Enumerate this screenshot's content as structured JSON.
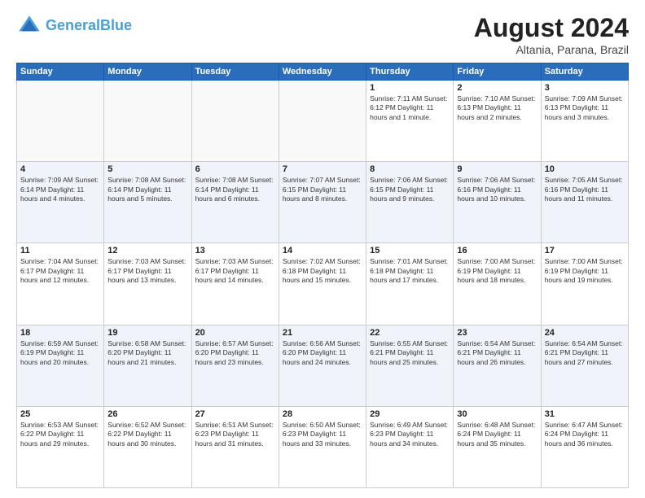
{
  "header": {
    "logo_line1": "General",
    "logo_line2": "Blue",
    "month_year": "August 2024",
    "location": "Altania, Parana, Brazil"
  },
  "days_of_week": [
    "Sunday",
    "Monday",
    "Tuesday",
    "Wednesday",
    "Thursday",
    "Friday",
    "Saturday"
  ],
  "weeks": [
    [
      {
        "day": "",
        "text": ""
      },
      {
        "day": "",
        "text": ""
      },
      {
        "day": "",
        "text": ""
      },
      {
        "day": "",
        "text": ""
      },
      {
        "day": "1",
        "text": "Sunrise: 7:11 AM\nSunset: 6:12 PM\nDaylight: 11 hours\nand 1 minute."
      },
      {
        "day": "2",
        "text": "Sunrise: 7:10 AM\nSunset: 6:13 PM\nDaylight: 11 hours\nand 2 minutes."
      },
      {
        "day": "3",
        "text": "Sunrise: 7:09 AM\nSunset: 6:13 PM\nDaylight: 11 hours\nand 3 minutes."
      }
    ],
    [
      {
        "day": "4",
        "text": "Sunrise: 7:09 AM\nSunset: 6:14 PM\nDaylight: 11 hours\nand 4 minutes."
      },
      {
        "day": "5",
        "text": "Sunrise: 7:08 AM\nSunset: 6:14 PM\nDaylight: 11 hours\nand 5 minutes."
      },
      {
        "day": "6",
        "text": "Sunrise: 7:08 AM\nSunset: 6:14 PM\nDaylight: 11 hours\nand 6 minutes."
      },
      {
        "day": "7",
        "text": "Sunrise: 7:07 AM\nSunset: 6:15 PM\nDaylight: 11 hours\nand 8 minutes."
      },
      {
        "day": "8",
        "text": "Sunrise: 7:06 AM\nSunset: 6:15 PM\nDaylight: 11 hours\nand 9 minutes."
      },
      {
        "day": "9",
        "text": "Sunrise: 7:06 AM\nSunset: 6:16 PM\nDaylight: 11 hours\nand 10 minutes."
      },
      {
        "day": "10",
        "text": "Sunrise: 7:05 AM\nSunset: 6:16 PM\nDaylight: 11 hours\nand 11 minutes."
      }
    ],
    [
      {
        "day": "11",
        "text": "Sunrise: 7:04 AM\nSunset: 6:17 PM\nDaylight: 11 hours\nand 12 minutes."
      },
      {
        "day": "12",
        "text": "Sunrise: 7:03 AM\nSunset: 6:17 PM\nDaylight: 11 hours\nand 13 minutes."
      },
      {
        "day": "13",
        "text": "Sunrise: 7:03 AM\nSunset: 6:17 PM\nDaylight: 11 hours\nand 14 minutes."
      },
      {
        "day": "14",
        "text": "Sunrise: 7:02 AM\nSunset: 6:18 PM\nDaylight: 11 hours\nand 15 minutes."
      },
      {
        "day": "15",
        "text": "Sunrise: 7:01 AM\nSunset: 6:18 PM\nDaylight: 11 hours\nand 17 minutes."
      },
      {
        "day": "16",
        "text": "Sunrise: 7:00 AM\nSunset: 6:19 PM\nDaylight: 11 hours\nand 18 minutes."
      },
      {
        "day": "17",
        "text": "Sunrise: 7:00 AM\nSunset: 6:19 PM\nDaylight: 11 hours\nand 19 minutes."
      }
    ],
    [
      {
        "day": "18",
        "text": "Sunrise: 6:59 AM\nSunset: 6:19 PM\nDaylight: 11 hours\nand 20 minutes."
      },
      {
        "day": "19",
        "text": "Sunrise: 6:58 AM\nSunset: 6:20 PM\nDaylight: 11 hours\nand 21 minutes."
      },
      {
        "day": "20",
        "text": "Sunrise: 6:57 AM\nSunset: 6:20 PM\nDaylight: 11 hours\nand 23 minutes."
      },
      {
        "day": "21",
        "text": "Sunrise: 6:56 AM\nSunset: 6:20 PM\nDaylight: 11 hours\nand 24 minutes."
      },
      {
        "day": "22",
        "text": "Sunrise: 6:55 AM\nSunset: 6:21 PM\nDaylight: 11 hours\nand 25 minutes."
      },
      {
        "day": "23",
        "text": "Sunrise: 6:54 AM\nSunset: 6:21 PM\nDaylight: 11 hours\nand 26 minutes."
      },
      {
        "day": "24",
        "text": "Sunrise: 6:54 AM\nSunset: 6:21 PM\nDaylight: 11 hours\nand 27 minutes."
      }
    ],
    [
      {
        "day": "25",
        "text": "Sunrise: 6:53 AM\nSunset: 6:22 PM\nDaylight: 11 hours\nand 29 minutes."
      },
      {
        "day": "26",
        "text": "Sunrise: 6:52 AM\nSunset: 6:22 PM\nDaylight: 11 hours\nand 30 minutes."
      },
      {
        "day": "27",
        "text": "Sunrise: 6:51 AM\nSunset: 6:23 PM\nDaylight: 11 hours\nand 31 minutes."
      },
      {
        "day": "28",
        "text": "Sunrise: 6:50 AM\nSunset: 6:23 PM\nDaylight: 11 hours\nand 33 minutes."
      },
      {
        "day": "29",
        "text": "Sunrise: 6:49 AM\nSunset: 6:23 PM\nDaylight: 11 hours\nand 34 minutes."
      },
      {
        "day": "30",
        "text": "Sunrise: 6:48 AM\nSunset: 6:24 PM\nDaylight: 11 hours\nand 35 minutes."
      },
      {
        "day": "31",
        "text": "Sunrise: 6:47 AM\nSunset: 6:24 PM\nDaylight: 11 hours\nand 36 minutes."
      }
    ]
  ]
}
